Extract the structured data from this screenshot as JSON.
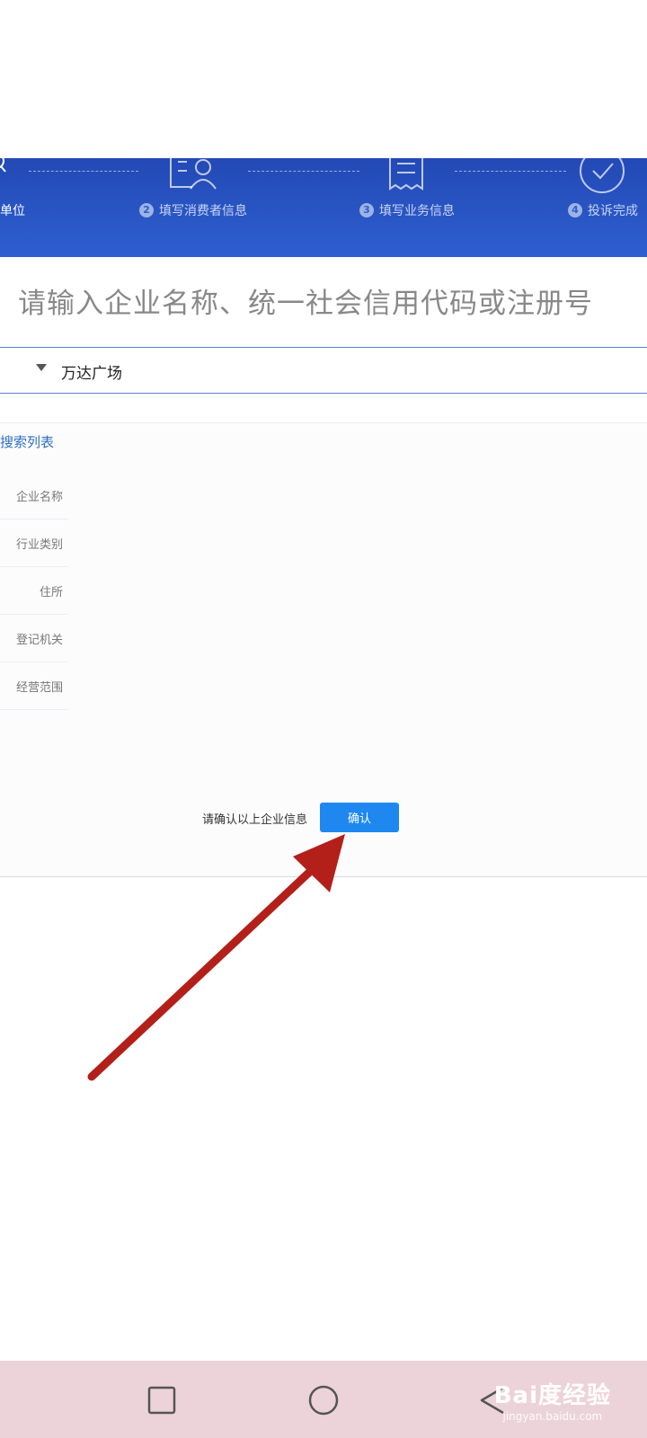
{
  "steps": [
    {
      "number": "",
      "label": "单位",
      "icon": "search-icon",
      "active": true
    },
    {
      "number": "2",
      "label": "填写消费者信息",
      "icon": "user-card-icon",
      "active": false
    },
    {
      "number": "3",
      "label": "填写业务信息",
      "icon": "receipt-icon",
      "active": false
    },
    {
      "number": "4",
      "label": "投诉完成",
      "icon": "check-circle-icon",
      "active": false
    }
  ],
  "search": {
    "prompt": "请输入企业名称、统一社会信用代码或注册号",
    "value": "万达广场"
  },
  "results": {
    "title": "搜索列表",
    "fields": [
      "企业名称",
      "行业类别",
      "住所",
      "登记机关",
      "经营范围"
    ],
    "confirm_prompt": "请确认以上企业信息",
    "confirm_button": "确认"
  },
  "watermark": {
    "logo": "Bai度经验",
    "url": "jingyan.baidu.com"
  },
  "colors": {
    "header_blue": "#2d5fd0",
    "button_blue": "#1e88f0",
    "arrow_red": "#b3201a",
    "navbar_pink": "#ecd3d9"
  }
}
